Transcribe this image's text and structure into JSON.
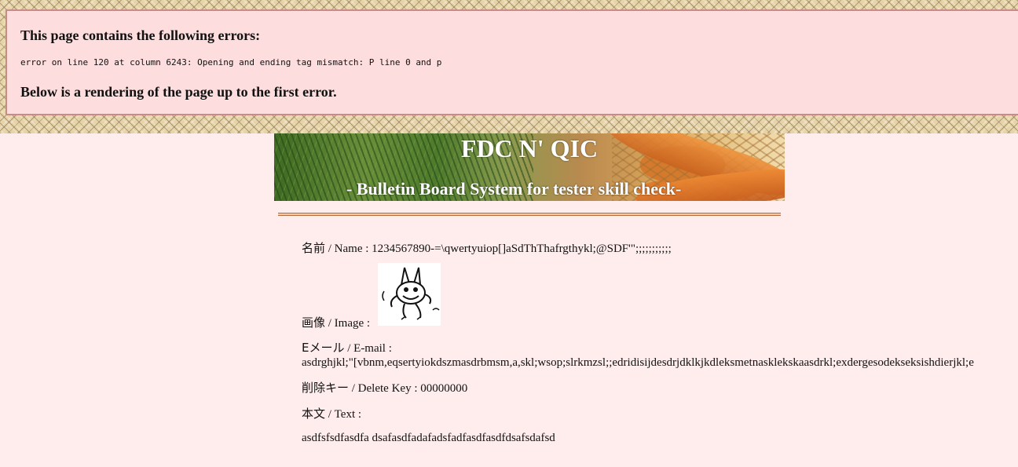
{
  "error": {
    "title": "This page contains the following errors:",
    "detail": "error on line 120 at column 6243: Opening and ending tag mismatch: P line 0 and p",
    "below": "Below is a rendering of the page up to the first error."
  },
  "banner": {
    "title": "FDC N' QIC",
    "subtitle": "- Bulletin Board System for tester skill check-"
  },
  "post": {
    "name_label_ja": "名前",
    "name_label_en": " / Name : ",
    "name_value": "1234567890-=\\qwertyuiop[]aSdThThafrgthykl;@SDF'\";;;;;;;;;;;",
    "image_label_ja": "画像",
    "image_label_en": " / Image : ",
    "image_icon": "rabbit-character-icon",
    "email_label_ja": "Eメール",
    "email_label_en": " / E-mail :",
    "email_value": "asdrghjkl;\"[vbnm,eqsertyiokdszmasdrbmsm,a,skl;wsop;slrkmzsl;;edridisijdesdrjdklkjkdleksmetnasklekskaasdrkl;exdergesodekseksishdierjkl;e",
    "delete_label_ja": "削除キー",
    "delete_label_en": " / Delete Key : ",
    "delete_value": "00000000",
    "text_label_ja": "本文",
    "text_label_en": " / Text :",
    "body": "asdfsfsdfasdfa dsafasdfadafadsfadfasdfasdfdsafsdafsd"
  }
}
